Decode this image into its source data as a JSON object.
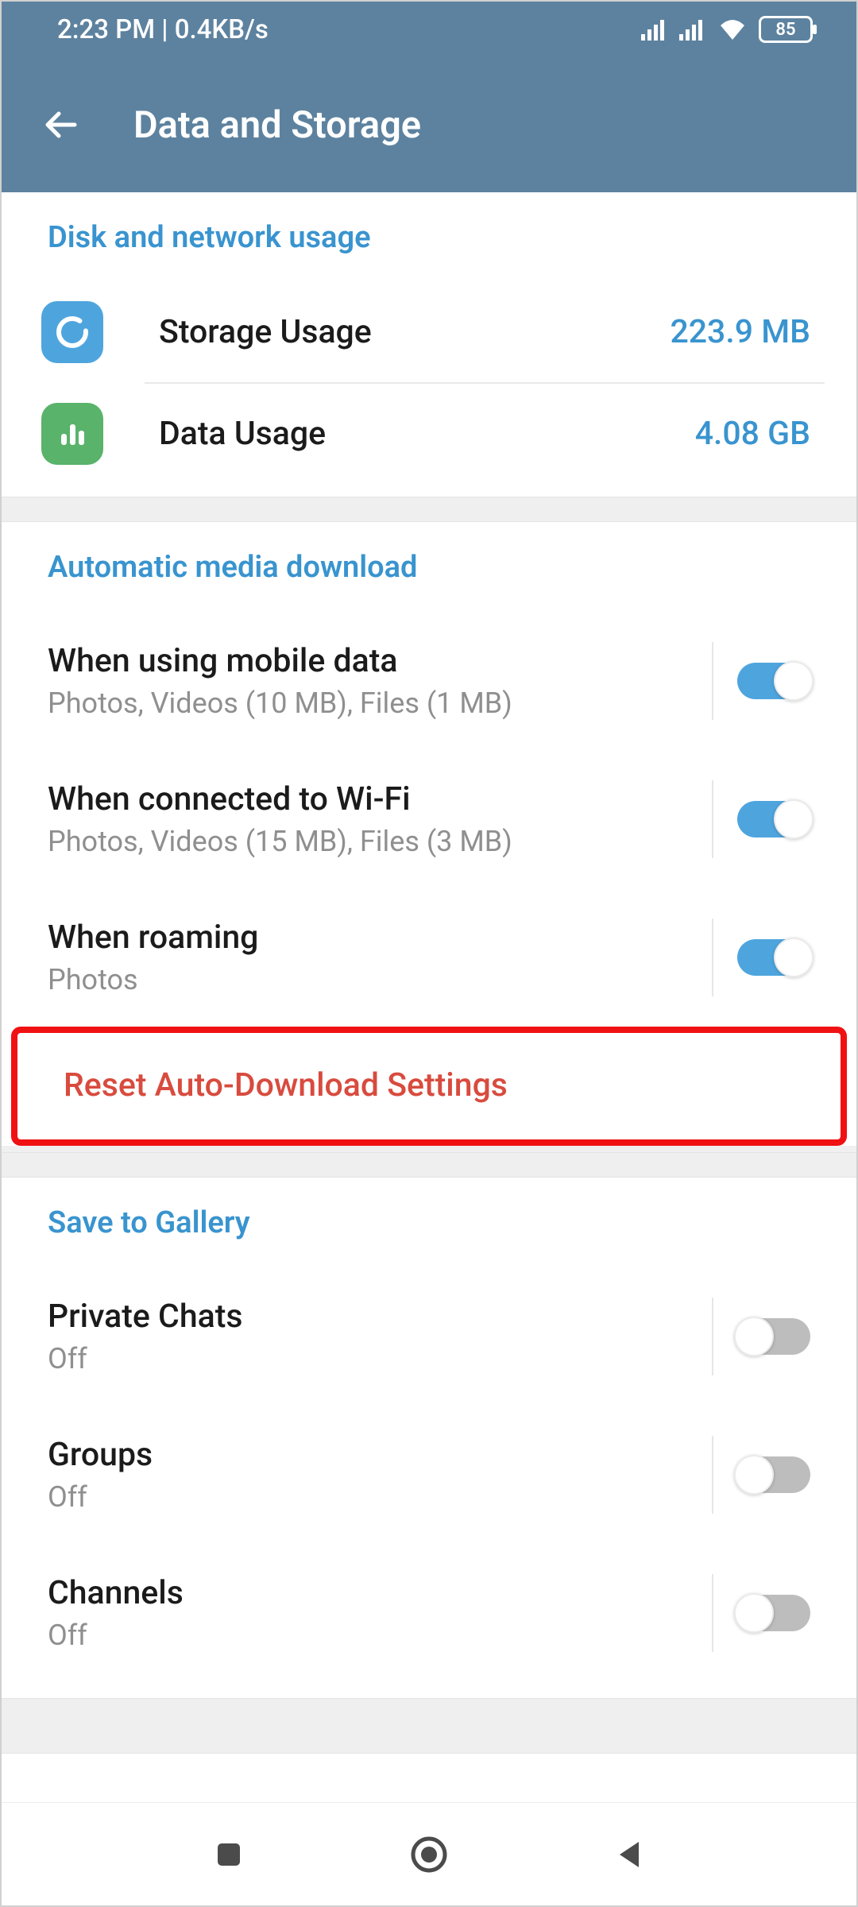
{
  "status": {
    "time": "2:23 PM | 0.4KB/s",
    "battery": "85"
  },
  "header": {
    "title": "Data and Storage"
  },
  "sections": {
    "disk": {
      "header": "Disk and network usage",
      "storage_label": "Storage Usage",
      "storage_value": "223.9 MB",
      "data_label": "Data Usage",
      "data_value": "4.08 GB"
    },
    "auto": {
      "header": "Automatic media download",
      "mobile_title": "When using mobile data",
      "mobile_sub": "Photos, Videos (10 MB), Files (1 MB)",
      "wifi_title": "When connected to Wi-Fi",
      "wifi_sub": "Photos, Videos (15 MB), Files (3 MB)",
      "roaming_title": "When roaming",
      "roaming_sub": "Photos",
      "reset": "Reset Auto-Download Settings"
    },
    "gallery": {
      "header": "Save to Gallery",
      "private_title": "Private Chats",
      "private_sub": "Off",
      "groups_title": "Groups",
      "groups_sub": "Off",
      "channels_title": "Channels",
      "channels_sub": "Off"
    }
  }
}
